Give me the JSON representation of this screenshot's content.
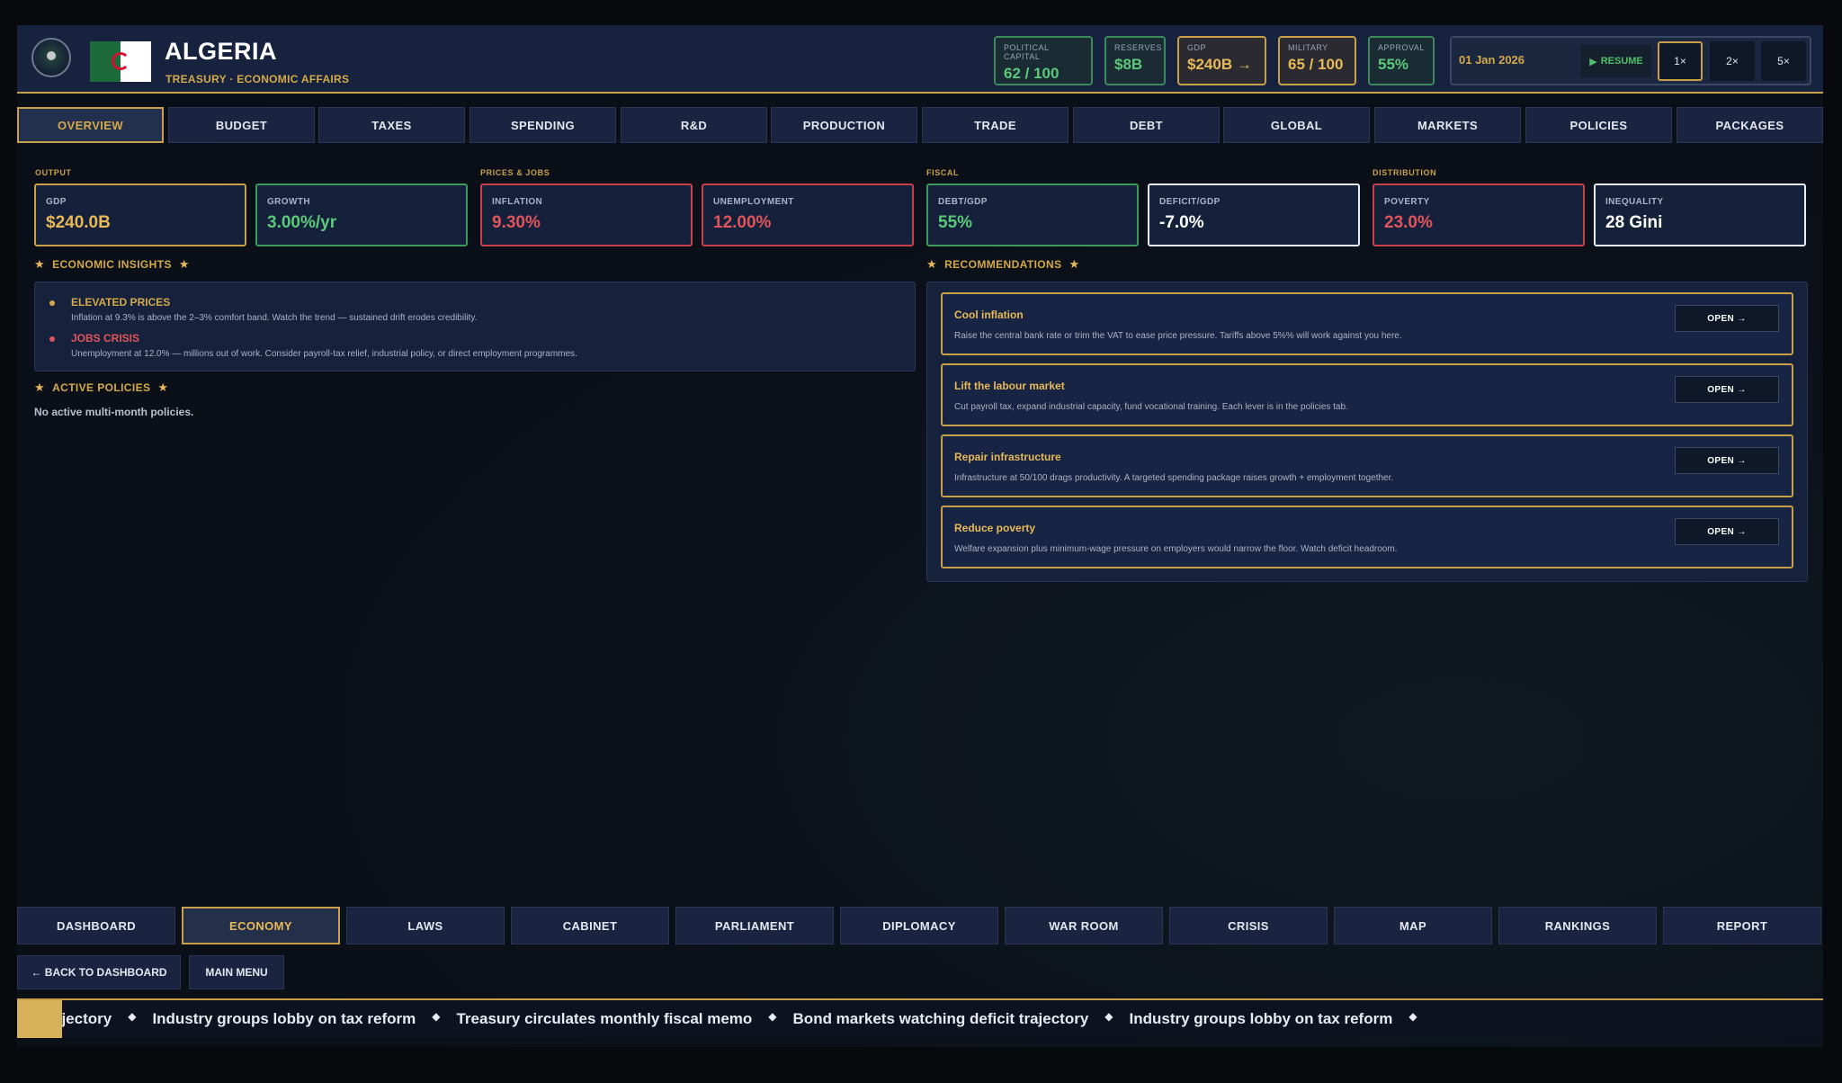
{
  "header": {
    "country": "ALGERIA",
    "department": "TREASURY · ECONOMIC AFFAIRS",
    "stats": [
      {
        "label": "POLITICAL CAPITAL",
        "value": "62 / 100",
        "tone": "green"
      },
      {
        "label": "RESERVES",
        "value": "$8B",
        "tone": "green"
      },
      {
        "label": "GDP",
        "value": "$240B →",
        "tone": "gold"
      },
      {
        "label": "MILITARY",
        "value": "65 / 100",
        "tone": "gold"
      },
      {
        "label": "APPROVAL",
        "value": "55%",
        "tone": "green"
      }
    ],
    "date": "01 Jan 2026",
    "resume_label": "RESUME",
    "speeds": [
      "1×",
      "2×",
      "5×"
    ],
    "active_speed": "1×"
  },
  "tabs": [
    "OVERVIEW",
    "BUDGET",
    "TAXES",
    "SPENDING",
    "R&D",
    "PRODUCTION",
    "TRADE",
    "DEBT",
    "GLOBAL",
    "MARKETS",
    "POLICIES",
    "PACKAGES"
  ],
  "active_tab": "OVERVIEW",
  "groups": [
    "OUTPUT",
    "PRICES & JOBS",
    "FISCAL",
    "DISTRIBUTION"
  ],
  "kpis": [
    {
      "label": "GDP",
      "value": "$240.0B",
      "tone": "gold"
    },
    {
      "label": "GROWTH",
      "value": "3.00%/yr",
      "tone": "green"
    },
    {
      "label": "INFLATION",
      "value": "9.30%",
      "tone": "red"
    },
    {
      "label": "UNEMPLOYMENT",
      "value": "12.00%",
      "tone": "red"
    },
    {
      "label": "DEBT/GDP",
      "value": "55%",
      "tone": "green"
    },
    {
      "label": "DEFICIT/GDP",
      "value": "-7.0%",
      "tone": "white"
    },
    {
      "label": "POVERTY",
      "value": "23.0%",
      "tone": "red"
    },
    {
      "label": "INEQUALITY",
      "value": "28 Gini",
      "tone": "white"
    }
  ],
  "insights": {
    "title": "ECONOMIC INSIGHTS",
    "items": [
      {
        "title": "ELEVATED PRICES",
        "text": "Inflation at 9.3% is above the 2–3% comfort band. Watch the trend — sustained drift erodes credibility.",
        "color": "#d4a94a"
      },
      {
        "title": "JOBS CRISIS",
        "text": "Unemployment at 12.0% — millions out of work. Consider payroll-tax relief, industrial policy, or direct employment programmes.",
        "color": "#e0555c"
      }
    ]
  },
  "active_policies": {
    "title": "ACTIVE POLICIES",
    "empty_text": "No active multi-month policies."
  },
  "recommendations": {
    "title": "RECOMMENDATIONS",
    "open_label": "OPEN →",
    "items": [
      {
        "title": "Cool inflation",
        "text": "Raise the central bank rate or trim the VAT to ease price pressure. Tariffs above 5%% will work against you here."
      },
      {
        "title": "Lift the labour market",
        "text": "Cut payroll tax, expand industrial capacity, fund vocational training. Each lever is in the policies tab."
      },
      {
        "title": "Repair infrastructure",
        "text": "Infrastructure at 50/100 drags productivity. A targeted spending package raises growth + employment together."
      },
      {
        "title": "Reduce poverty",
        "text": "Welfare expansion plus minimum-wage pressure on employers would narrow the floor. Watch deficit headroom."
      }
    ]
  },
  "bottom_nav": [
    "DASHBOARD",
    "ECONOMY",
    "LAWS",
    "CABINET",
    "PARLIAMENT",
    "DIPLOMACY",
    "WAR ROOM",
    "CRISIS",
    "MAP",
    "RANKINGS",
    "REPORT"
  ],
  "active_bottom": "ECONOMY",
  "secondary": [
    "← BACK TO DASHBOARD",
    "MAIN MENU"
  ],
  "ticker": [
    "ajectory",
    "Industry groups lobby on tax reform",
    "Treasury circulates monthly fiscal memo",
    "Bond markets watching deficit trajectory",
    "Industry groups lobby on tax reform"
  ],
  "colors": {
    "accent": "#c8a04a",
    "green": "#5cc87a",
    "red": "#e0555c",
    "panel": "#16213b"
  }
}
